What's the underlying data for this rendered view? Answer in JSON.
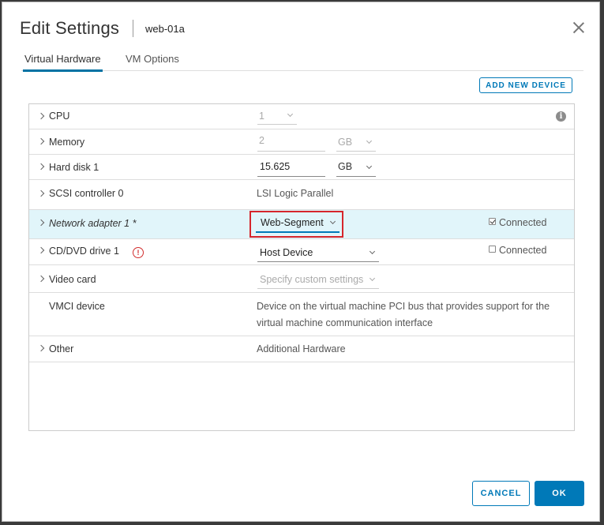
{
  "dialog": {
    "title": "Edit Settings",
    "vm_name": "web-01a"
  },
  "tabs": [
    {
      "label": "Virtual Hardware",
      "active": true
    },
    {
      "label": "VM Options",
      "active": false
    }
  ],
  "toolbar": {
    "add_new_device": "ADD NEW DEVICE"
  },
  "hardware": {
    "cpu": {
      "label": "CPU",
      "value": "1"
    },
    "memory": {
      "label": "Memory",
      "value": "2",
      "unit": "GB"
    },
    "hard_disk": {
      "label": "Hard disk 1",
      "value": "15.625",
      "unit": "GB"
    },
    "scsi": {
      "label": "SCSI controller 0",
      "value": "LSI Logic Parallel"
    },
    "network": {
      "label": "Network adapter 1 *",
      "value": "Web-Segment",
      "connected_label": "Connected",
      "connected": true
    },
    "cddvd": {
      "label": "CD/DVD drive 1",
      "value": "Host Device",
      "connected_label": "Connected",
      "connected": false
    },
    "video": {
      "label": "Video card",
      "value": "Specify custom settings"
    },
    "vmci": {
      "label": "VMCI device",
      "desc_line1": "Device on the virtual machine PCI bus that provides support for the",
      "desc_line2": "virtual machine communication interface"
    },
    "other": {
      "label": "Other",
      "value": "Additional Hardware"
    }
  },
  "icons": {
    "info": "i",
    "warning": "!"
  },
  "footer": {
    "cancel": "CANCEL",
    "ok": "OK"
  },
  "colors": {
    "accent": "#0079b8",
    "highlight_row": "#e1f5fa",
    "callout": "#d6262c"
  }
}
